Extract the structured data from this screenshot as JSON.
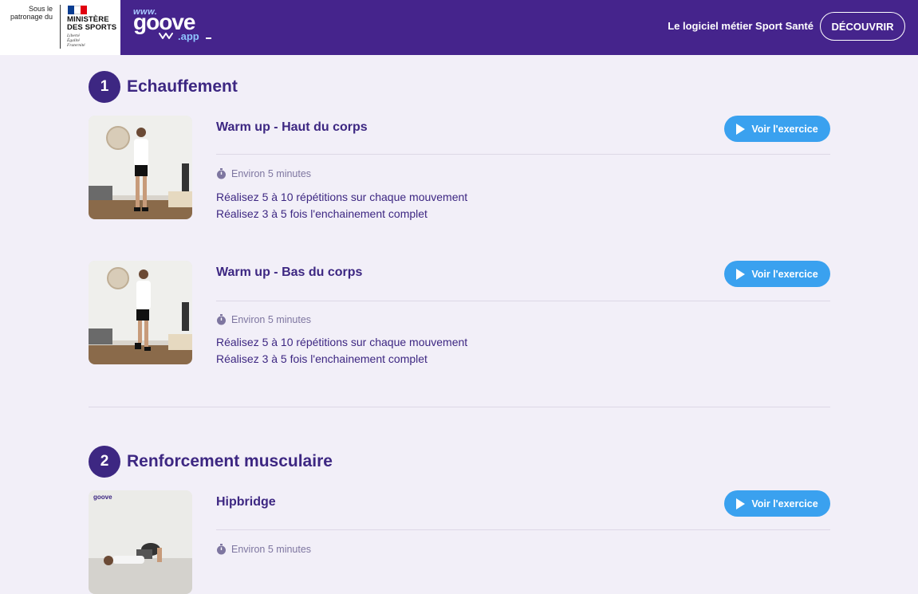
{
  "header": {
    "patronage_text": "Sous le patronage du",
    "ministry_name_line1": "MINISTÈRE",
    "ministry_name_line2": "DES SPORTS",
    "ministry_motto_1": "Liberté",
    "ministry_motto_2": "Égalité",
    "ministry_motto_3": "Fraternité",
    "logo_www": "www.",
    "logo_name": "goove",
    "logo_app": ".app",
    "tagline": "Le logiciel métier Sport Santé",
    "discover_label": "DÉCOUVRIR",
    "colors": {
      "bar": "#45248c",
      "accent": "#3aa1ef"
    }
  },
  "sections": [
    {
      "number": "1",
      "title": "Echauffement",
      "exercises": [
        {
          "title": "Warm up - Haut du corps",
          "button": "Voir l'exercice",
          "duration": "Environ 5 minutes",
          "line1": "Réalisez 5 à 10 répétitions sur chaque mouvement",
          "line2": "Réalisez 3 à 5 fois l'enchainement complet"
        },
        {
          "title": "Warm up - Bas du corps",
          "button": "Voir l'exercice",
          "duration": "Environ 5 minutes",
          "line1": "Réalisez 5 à 10 répétitions sur chaque mouvement",
          "line2": "Réalisez 3 à 5 fois l'enchainement complet"
        }
      ]
    },
    {
      "number": "2",
      "title": "Renforcement musculaire",
      "exercises": [
        {
          "title": "Hipbridge",
          "button": "Voir l'exercice",
          "duration": "Environ 5 minutes",
          "thumb_logo": "goove"
        }
      ]
    }
  ],
  "icons": {
    "play": "play-icon",
    "timer": "stopwatch-icon"
  }
}
